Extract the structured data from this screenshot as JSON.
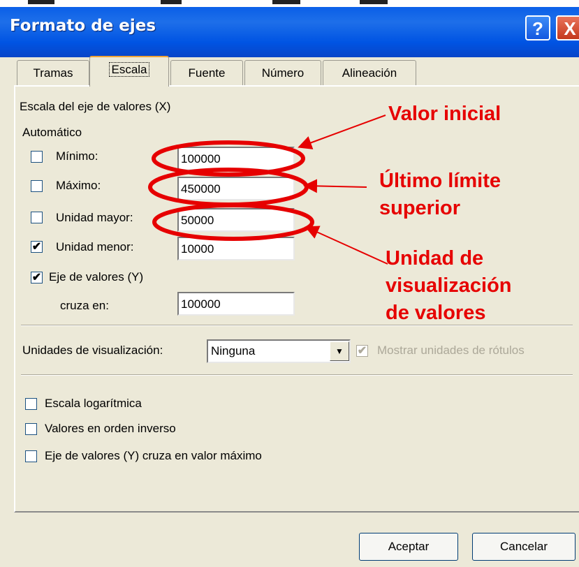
{
  "window": {
    "title": "Formato de ejes",
    "help_glyph": "?",
    "close_glyph": "X"
  },
  "tabs": [
    "Tramas",
    "Escala",
    "Fuente",
    "Número",
    "Alineación"
  ],
  "active_tab": "Escala",
  "scale": {
    "heading": "Escala del eje de valores (X)",
    "auto_label": "Automático",
    "fields": [
      {
        "label": "Mínimo:",
        "value": "100000",
        "checked": false
      },
      {
        "label": "Máximo:",
        "value": "450000",
        "checked": false
      },
      {
        "label": "Unidad mayor:",
        "value": "50000",
        "checked": false
      },
      {
        "label": "Unidad menor:",
        "value": "10000",
        "checked": true
      }
    ],
    "cross_checkbox": "Eje de valores (Y)",
    "cross_label": "cruza en:",
    "cross_value": "100000"
  },
  "display_units": {
    "label": "Unidades de visualización:",
    "value": "Ninguna",
    "show_labels": "Mostrar unidades de rótulos"
  },
  "options": [
    "Escala logarítmica",
    "Valores en orden inverso",
    "Eje de valores (Y) cruza en valor máximo"
  ],
  "buttons": {
    "ok": "Aceptar",
    "cancel": "Cancelar"
  },
  "annotations": {
    "initial": "Valor inicial",
    "upper_1": "Último límite",
    "upper_2": "superior",
    "unit_1": "Unidad de",
    "unit_2": "visualización",
    "unit_3": "de valores"
  },
  "colors": {
    "annotation": "#e60000",
    "titlebar": "#0054e3",
    "dialog_bg": "#ece9d8"
  },
  "icons": {
    "checkmark": "✔",
    "dropdown": "▼"
  }
}
